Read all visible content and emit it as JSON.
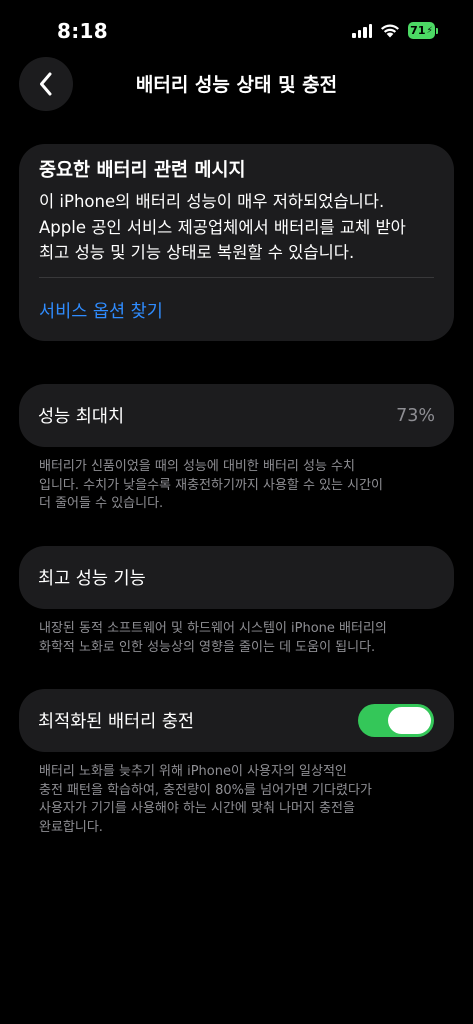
{
  "status_bar": {
    "time": "8:18",
    "battery_level": "71",
    "battery_color": "#4cd964"
  },
  "nav": {
    "back_icon": "chevron-left-icon",
    "title": "배터리 성능 상태 및 충전"
  },
  "alert": {
    "title": "중요한 배터리 관련 메시지",
    "body_lines": [
      "이 iPhone의 배터리 성능이 매우 저하되었습니다.",
      "Apple 공인 서비스 제공업체에서 배터리를 교체 받아",
      "최고 성능 및 기능 상태로 복원할 수 있습니다."
    ],
    "link": "서비스 옵션 찾기",
    "link_color": "#2f8cff"
  },
  "max_capacity": {
    "label": "성능 최대치",
    "value": "73%",
    "footnote_lines": [
      "배터리가 신품이었을 때의 성능에 대비한 배터리 성능 수치",
      "입니다. 수치가 낮을수록 재충전하기까지 사용할 수 있는 시간이",
      "더 줄어들 수 있습니다."
    ]
  },
  "peak_performance": {
    "label": "최고 성능 기능",
    "footnote_lines": [
      "내장된 동적 소프트웨어 및 하드웨어 시스템이 iPhone 배터리의",
      "화학적 노화로 인한 성능상의 영향을 줄이는 데 도움이 됩니다."
    ]
  },
  "optimized_charging": {
    "label": "최적화된 배터리 충전",
    "enabled": true,
    "toggle_color": "#34c759",
    "footnote_lines": [
      "배터리 노화를 늦추기 위해 iPhone이 사용자의 일상적인",
      "충전 패턴을 학습하여, 충전량이 80%를 넘어가면 기다렸다가",
      "사용자가 기기를 사용해야 하는 시간에 맞춰 나머지 충전을",
      "완료합니다."
    ]
  }
}
